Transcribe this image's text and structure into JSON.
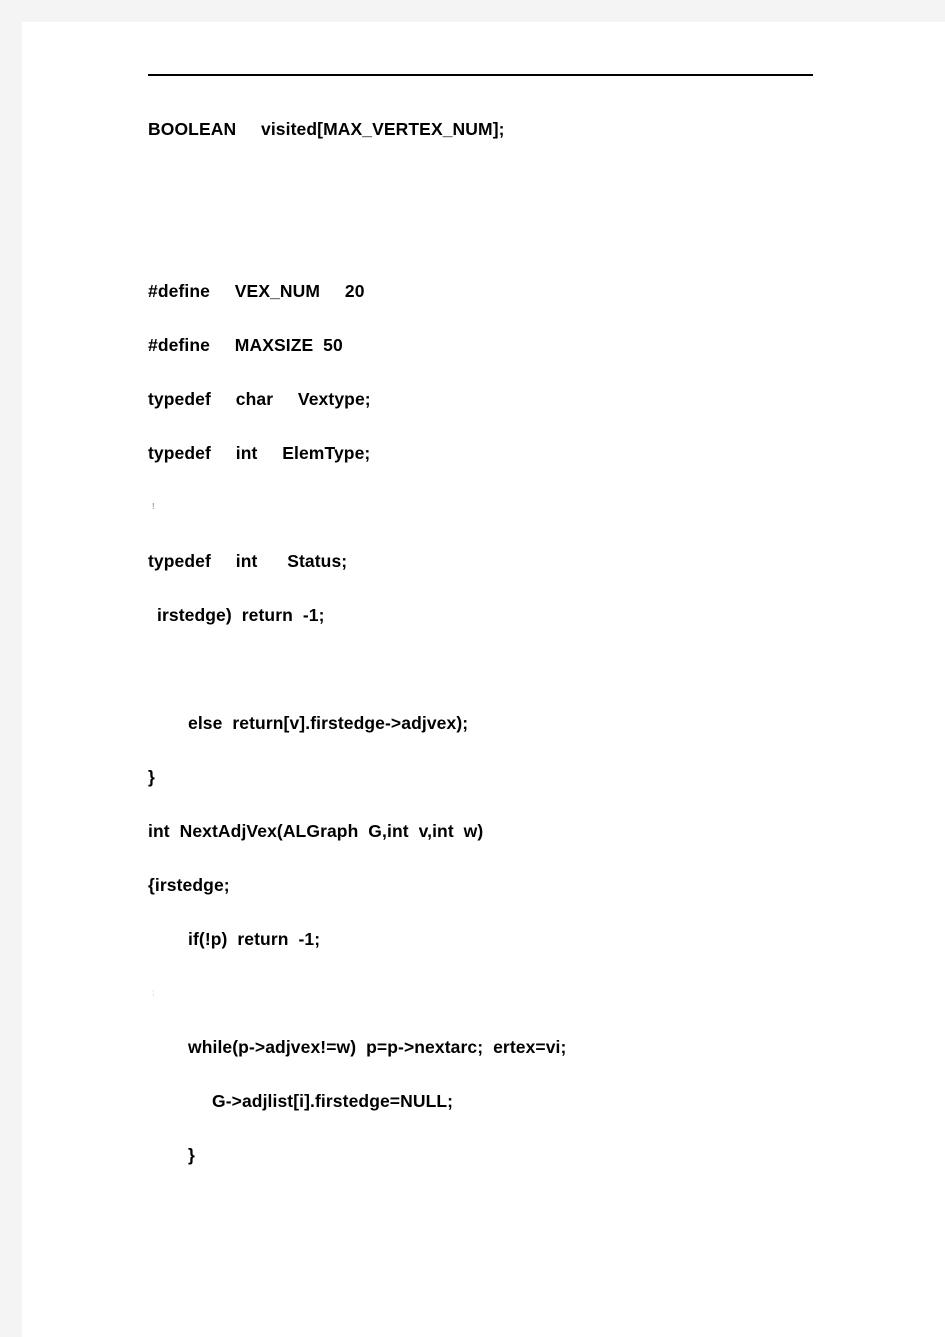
{
  "page": {
    "background_color": "#f4f4f4",
    "paper_color": "#ffffff",
    "text_color": "#000000"
  },
  "divider": {
    "name": "horizontal-rule"
  },
  "document": {
    "lines": [
      {
        "text": "BOOLEAN     visited[MAX_VERTEX_NUM];",
        "indent": 0,
        "kind": "code"
      },
      {
        "text": "",
        "indent": 0,
        "kind": "blank"
      },
      {
        "text": "",
        "indent": 0,
        "kind": "blank"
      },
      {
        "text": "#define     VEX_NUM     20",
        "indent": 0,
        "kind": "code"
      },
      {
        "text": "#define     MAXSIZE  50",
        "indent": 0,
        "kind": "code"
      },
      {
        "text": "typedef     char     Vextype;",
        "indent": 0,
        "kind": "code"
      },
      {
        "text": "typedef     int     ElemType;",
        "indent": 0,
        "kind": "code"
      },
      {
        "text": "!",
        "indent": 0,
        "kind": "artifact"
      },
      {
        "text": "typedef     int      Status;",
        "indent": 0,
        "kind": "code"
      },
      {
        "text": "irstedge)  return  -1;",
        "indent": 1,
        "kind": "code"
      },
      {
        "text": "",
        "indent": 0,
        "kind": "blank"
      },
      {
        "text": "else  return[v].firstedge->adjvex);",
        "indent": 2,
        "kind": "code"
      },
      {
        "text": "}",
        "indent": 0,
        "kind": "code"
      },
      {
        "text": "int  NextAdjVex(ALGraph  G,int  v,int  w)",
        "indent": 0,
        "kind": "code"
      },
      {
        "text": "{irstedge;",
        "indent": 0,
        "kind": "code"
      },
      {
        "text": "if(!p)  return  -1;",
        "indent": 2,
        "kind": "code"
      },
      {
        "text": ";",
        "indent": 0,
        "kind": "artifact-faint"
      },
      {
        "text": "while(p->adjvex!=w)  p=p->nextarc;  ertex=vi;",
        "indent": 2,
        "kind": "code"
      },
      {
        "text": "G->adjlist[i].firstedge=NULL;",
        "indent": 3,
        "kind": "code"
      },
      {
        "text": "}",
        "indent": 2,
        "kind": "code"
      }
    ]
  }
}
